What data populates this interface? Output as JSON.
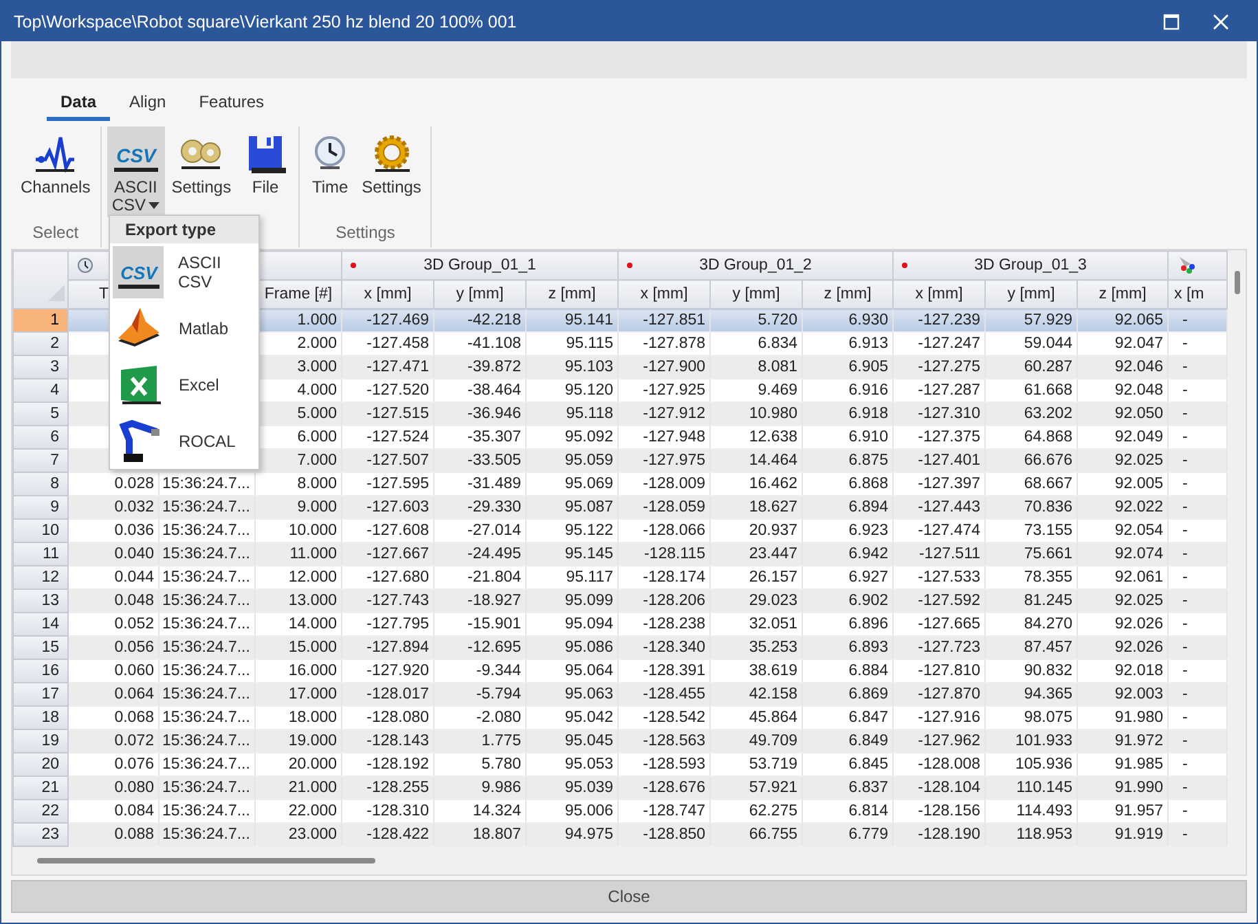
{
  "window": {
    "title": "Top\\Workspace\\Robot square\\Vierkant 250 hz blend 20 100% 001"
  },
  "ribbon": {
    "tabs": [
      {
        "label": "Data",
        "selected": true
      },
      {
        "label": "Align",
        "selected": false
      },
      {
        "label": "Features",
        "selected": false
      }
    ],
    "groups": [
      {
        "label": "Select",
        "buttons": [
          {
            "label": "Channels",
            "pressed": false,
            "dropdown": false
          }
        ]
      },
      {
        "buttons": [
          {
            "label": "ASCII CSV",
            "logo": "CSV",
            "pressed": true,
            "dropdown": true
          },
          {
            "label": "Settings",
            "pressed": false,
            "dropdown": false
          },
          {
            "label": "File",
            "pressed": false,
            "dropdown": false
          }
        ]
      },
      {
        "label": "Settings",
        "buttons": [
          {
            "label": "Time",
            "pressed": false,
            "dropdown": false
          },
          {
            "label": "Settings",
            "pressed": false,
            "dropdown": false
          }
        ]
      }
    ]
  },
  "export_menu": {
    "title": "Export type",
    "items": [
      {
        "label": "ASCII CSV",
        "logo": "CSV",
        "selected": true
      },
      {
        "label": "Matlab",
        "selected": false
      },
      {
        "label": "Excel",
        "selected": false
      },
      {
        "label": "ROCAL",
        "selected": false
      }
    ]
  },
  "table": {
    "groups": [
      {
        "kind": "clock",
        "columns": [
          "T",
          null,
          "Frame [#]"
        ]
      },
      {
        "kind": "marker",
        "label": "3D Group_01_1",
        "columns": [
          "x [mm]",
          "y [mm]",
          "z [mm]"
        ]
      },
      {
        "kind": "marker",
        "label": "3D Group_01_2",
        "columns": [
          "x [mm]",
          "y [mm]",
          "z [mm]"
        ]
      },
      {
        "kind": "marker",
        "label": "3D Group_01_3",
        "columns": [
          "x [mm]",
          "y [mm]",
          "z [mm]"
        ]
      },
      {
        "kind": "colored",
        "columns": [
          "x [m"
        ]
      }
    ],
    "rows": [
      {
        "number": "1",
        "selected": true,
        "cells": [
          null,
          null,
          "1.000",
          "-127.469",
          "-42.218",
          "95.141",
          "-127.851",
          "5.720",
          "6.930",
          "-127.239",
          "57.929",
          "92.065",
          "-"
        ]
      },
      {
        "number": "2",
        "selected": false,
        "cells": [
          null,
          null,
          "2.000",
          "-127.458",
          "-41.108",
          "95.115",
          "-127.878",
          "6.834",
          "6.913",
          "-127.247",
          "59.044",
          "92.047",
          "-"
        ]
      },
      {
        "number": "3",
        "selected": false,
        "cells": [
          null,
          null,
          "3.000",
          "-127.471",
          "-39.872",
          "95.103",
          "-127.900",
          "8.081",
          "6.905",
          "-127.275",
          "60.287",
          "92.046",
          "-"
        ]
      },
      {
        "number": "4",
        "selected": false,
        "cells": [
          null,
          null,
          "4.000",
          "-127.520",
          "-38.464",
          "95.120",
          "-127.925",
          "9.469",
          "6.916",
          "-127.287",
          "61.668",
          "92.048",
          "-"
        ]
      },
      {
        "number": "5",
        "selected": false,
        "cells": [
          null,
          null,
          "5.000",
          "-127.515",
          "-36.946",
          "95.118",
          "-127.912",
          "10.980",
          "6.918",
          "-127.310",
          "63.202",
          "92.050",
          "-"
        ]
      },
      {
        "number": "6",
        "selected": false,
        "cells": [
          null,
          null,
          "6.000",
          "-127.524",
          "-35.307",
          "95.092",
          "-127.948",
          "12.638",
          "6.910",
          "-127.375",
          "64.868",
          "92.049",
          "-"
        ]
      },
      {
        "number": "7",
        "selected": false,
        "cells": [
          null,
          null,
          "7.000",
          "-127.507",
          "-33.505",
          "95.059",
          "-127.975",
          "14.464",
          "6.875",
          "-127.401",
          "66.676",
          "92.025",
          "-"
        ]
      },
      {
        "number": "8",
        "selected": false,
        "cells": [
          "0.028",
          "15:36:24.7...",
          "8.000",
          "-127.595",
          "-31.489",
          "95.069",
          "-128.009",
          "16.462",
          "6.868",
          "-127.397",
          "68.667",
          "92.005",
          "-"
        ]
      },
      {
        "number": "9",
        "selected": false,
        "cells": [
          "0.032",
          "15:36:24.7...",
          "9.000",
          "-127.603",
          "-29.330",
          "95.087",
          "-128.059",
          "18.627",
          "6.894",
          "-127.443",
          "70.836",
          "92.022",
          "-"
        ]
      },
      {
        "number": "10",
        "selected": false,
        "cells": [
          "0.036",
          "15:36:24.7...",
          "10.000",
          "-127.608",
          "-27.014",
          "95.122",
          "-128.066",
          "20.937",
          "6.923",
          "-127.474",
          "73.155",
          "92.054",
          "-"
        ]
      },
      {
        "number": "11",
        "selected": false,
        "cells": [
          "0.040",
          "15:36:24.7...",
          "11.000",
          "-127.667",
          "-24.495",
          "95.145",
          "-128.115",
          "23.447",
          "6.942",
          "-127.511",
          "75.661",
          "92.074",
          "-"
        ]
      },
      {
        "number": "12",
        "selected": false,
        "cells": [
          "0.044",
          "15:36:24.7...",
          "12.000",
          "-127.680",
          "-21.804",
          "95.117",
          "-128.174",
          "26.157",
          "6.927",
          "-127.533",
          "78.355",
          "92.061",
          "-"
        ]
      },
      {
        "number": "13",
        "selected": false,
        "cells": [
          "0.048",
          "15:36:24.7...",
          "13.000",
          "-127.743",
          "-18.927",
          "95.099",
          "-128.206",
          "29.023",
          "6.902",
          "-127.592",
          "81.245",
          "92.025",
          "-"
        ]
      },
      {
        "number": "14",
        "selected": false,
        "cells": [
          "0.052",
          "15:36:24.7...",
          "14.000",
          "-127.795",
          "-15.901",
          "95.094",
          "-128.238",
          "32.051",
          "6.896",
          "-127.665",
          "84.270",
          "92.026",
          "-"
        ]
      },
      {
        "number": "15",
        "selected": false,
        "cells": [
          "0.056",
          "15:36:24.7...",
          "15.000",
          "-127.894",
          "-12.695",
          "95.086",
          "-128.340",
          "35.253",
          "6.893",
          "-127.723",
          "87.457",
          "92.026",
          "-"
        ]
      },
      {
        "number": "16",
        "selected": false,
        "cells": [
          "0.060",
          "15:36:24.7...",
          "16.000",
          "-127.920",
          "-9.344",
          "95.064",
          "-128.391",
          "38.619",
          "6.884",
          "-127.810",
          "90.832",
          "92.018",
          "-"
        ]
      },
      {
        "number": "17",
        "selected": false,
        "cells": [
          "0.064",
          "15:36:24.7...",
          "17.000",
          "-128.017",
          "-5.794",
          "95.063",
          "-128.455",
          "42.158",
          "6.869",
          "-127.870",
          "94.365",
          "92.003",
          "-"
        ]
      },
      {
        "number": "18",
        "selected": false,
        "cells": [
          "0.068",
          "15:36:24.7...",
          "18.000",
          "-128.080",
          "-2.080",
          "95.042",
          "-128.542",
          "45.864",
          "6.847",
          "-127.916",
          "98.075",
          "91.980",
          "-"
        ]
      },
      {
        "number": "19",
        "selected": false,
        "cells": [
          "0.072",
          "15:36:24.7...",
          "19.000",
          "-128.143",
          "1.775",
          "95.045",
          "-128.563",
          "49.709",
          "6.849",
          "-127.962",
          "101.933",
          "91.972",
          "-"
        ]
      },
      {
        "number": "20",
        "selected": false,
        "cells": [
          "0.076",
          "15:36:24.7...",
          "20.000",
          "-128.192",
          "5.780",
          "95.053",
          "-128.593",
          "53.719",
          "6.845",
          "-128.008",
          "105.936",
          "91.985",
          "-"
        ]
      },
      {
        "number": "21",
        "selected": false,
        "cells": [
          "0.080",
          "15:36:24.7...",
          "21.000",
          "-128.255",
          "9.986",
          "95.039",
          "-128.676",
          "57.921",
          "6.837",
          "-128.104",
          "110.145",
          "91.990",
          "-"
        ]
      },
      {
        "number": "22",
        "selected": false,
        "cells": [
          "0.084",
          "15:36:24.7...",
          "22.000",
          "-128.310",
          "14.324",
          "95.006",
          "-128.747",
          "62.275",
          "6.814",
          "-128.156",
          "114.493",
          "91.957",
          "-"
        ]
      },
      {
        "number": "23",
        "selected": false,
        "cells": [
          "0.088",
          "15:36:24.7...",
          "23.000",
          "-128.422",
          "18.807",
          "94.975",
          "-128.850",
          "66.755",
          "6.779",
          "-128.190",
          "118.953",
          "91.919",
          "-"
        ]
      }
    ]
  },
  "close_button": {
    "label": "Close"
  }
}
